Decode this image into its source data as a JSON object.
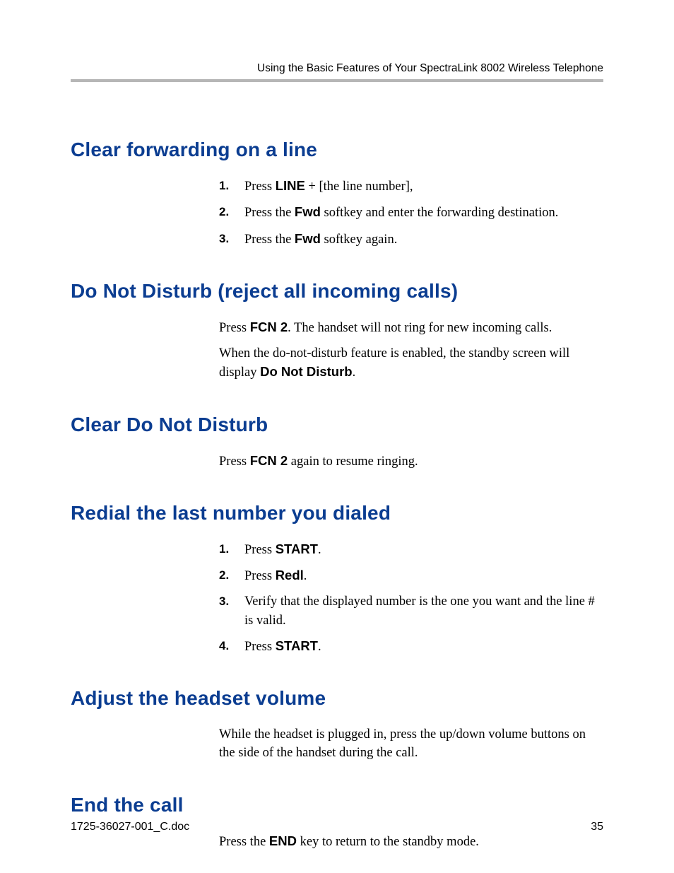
{
  "header": {
    "running_title": "Using the Basic Features of Your SpectraLink 8002 Wireless Telephone"
  },
  "sections": {
    "clear_forwarding": {
      "title": "Clear forwarding on a line",
      "steps": [
        {
          "n": "1.",
          "pre": "Press ",
          "bold": "LINE",
          "post": " + [the line number],"
        },
        {
          "n": "2.",
          "pre": "Press the ",
          "bold": "Fwd",
          "post": " softkey and enter the forwarding destination."
        },
        {
          "n": "3.",
          "pre": "Press the ",
          "bold": "Fwd",
          "post": " softkey again."
        }
      ]
    },
    "dnd": {
      "title": "Do Not Disturb (reject all incoming calls)",
      "p1_pre": "Press ",
      "p1_bold": "FCN 2",
      "p1_post": ". The handset will not ring for new incoming calls.",
      "p2_pre": "When the do-not-disturb feature is enabled, the standby screen will display ",
      "p2_bold": "Do Not Disturb",
      "p2_post": "."
    },
    "clear_dnd": {
      "title": "Clear Do Not Disturb",
      "p1_pre": "Press ",
      "p1_bold": "FCN 2",
      "p1_post": " again to resume ringing."
    },
    "redial": {
      "title": "Redial the last number you dialed",
      "steps": [
        {
          "n": "1.",
          "pre": "Press ",
          "bold": "START",
          "post": "."
        },
        {
          "n": "2.",
          "pre": "Press ",
          "bold": "Redl",
          "post": "."
        },
        {
          "n": "3.",
          "pre": "",
          "bold": "",
          "post": "Verify that the displayed number is the one you want and the line # is valid."
        },
        {
          "n": "4.",
          "pre": "Press ",
          "bold": "START",
          "post": "."
        }
      ]
    },
    "volume": {
      "title": "Adjust the headset volume",
      "p1": "While the headset is plugged in, press the up/down volume buttons on the side of the handset during the call."
    },
    "end_call": {
      "title": "End the call",
      "p1_pre": "Press the ",
      "p1_bold": "END",
      "p1_post": " key to return to the standby mode."
    }
  },
  "footer": {
    "doc_id": "1725-36027-001_C.doc",
    "page_number": "35"
  }
}
